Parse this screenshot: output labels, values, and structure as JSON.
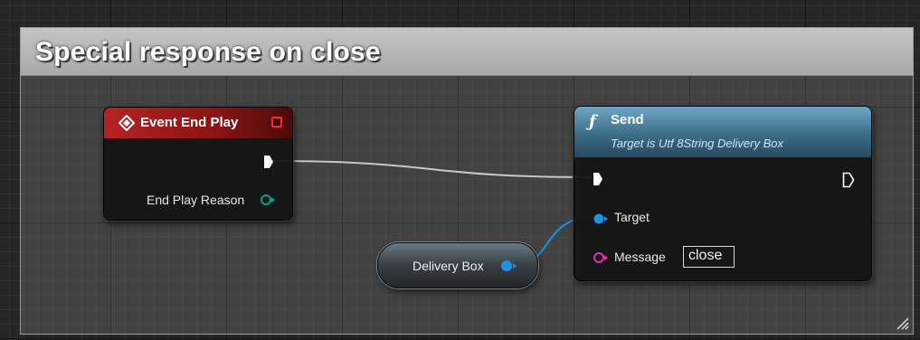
{
  "comment": {
    "title": "Special response on close"
  },
  "event_node": {
    "title": "Event End Play",
    "header_color": "#b52323",
    "pins": [
      {
        "kind": "exec-out"
      },
      {
        "kind": "data-out",
        "label": "End Play Reason",
        "color": "#00a88f"
      }
    ]
  },
  "send_node": {
    "icon": "function-icon",
    "icon_glyph": "ƒ",
    "title": "Send",
    "subtitle": "Target is Utf 8String Delivery Box",
    "header_color": "#3b6c88",
    "target_label": "Target",
    "target_color": "#1e90e6",
    "message_label": "Message",
    "message_color": "#e62ab8",
    "message_value": "close"
  },
  "variable_node": {
    "label": "Delivery Box",
    "pin_color": "#1e90e6"
  },
  "colors": {
    "exec_wire": "#c8c8c8",
    "object_wire": "#1e90e6"
  }
}
